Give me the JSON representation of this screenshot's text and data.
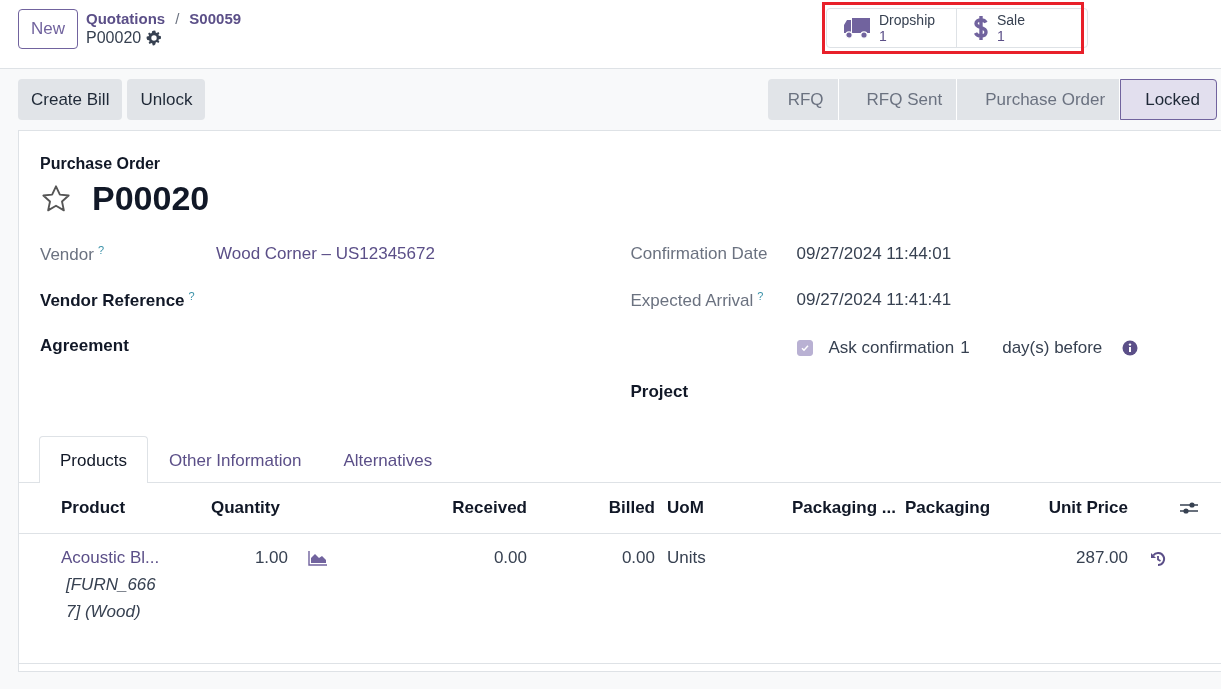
{
  "control_panel": {
    "new_button": "New",
    "breadcrumbs": [
      "Quotations",
      "S00059"
    ],
    "separator": "/",
    "record_name": "P00020"
  },
  "smart_buttons": [
    {
      "kind": "truck",
      "label": "Dropship",
      "value": "1"
    },
    {
      "kind": "dollar",
      "label": "Sale",
      "value": "1"
    }
  ],
  "highlighted": true,
  "action_buttons": [
    "Create Bill",
    "Unlock"
  ],
  "status_bar": [
    {
      "label": "RFQ",
      "selected": false
    },
    {
      "label": "RFQ Sent",
      "selected": false
    },
    {
      "label": "Purchase Order",
      "selected": false
    },
    {
      "label": "Locked",
      "selected": true
    }
  ],
  "form": {
    "caption": "Purchase Order",
    "starred": false,
    "name": "P00020",
    "left_fields": [
      {
        "label": "Vendor",
        "help": "?",
        "value": "Wood Corner – US12345672",
        "required": false
      },
      {
        "label": "Vendor Reference",
        "help": "?",
        "required": true
      },
      {
        "label": "Agreement",
        "required": true
      }
    ],
    "right_fields": [
      {
        "label": "Confirmation Date",
        "value": "09/27/2024 11:44:01",
        "required": false
      },
      {
        "label": "Expected Arrival",
        "help": "?",
        "value": "09/27/2024 11:41:41",
        "required": false
      }
    ],
    "confirmation": {
      "checked": true,
      "label": "Ask confirmation",
      "days": "1",
      "suffix": "day(s) before"
    },
    "project_label": "Project"
  },
  "tabs": [
    {
      "label": "Products",
      "selected": true
    },
    {
      "label": "Other Information",
      "selected": false
    },
    {
      "label": "Alternatives",
      "selected": false
    }
  ],
  "table": {
    "columns": [
      "Product",
      "Quantity",
      "Received",
      "Billed",
      "UoM",
      "Packaging ...",
      "Packaging",
      "Unit Price"
    ],
    "rows": [
      {
        "product": "Acoustic Bl...",
        "variant": "[FURN_6667] (Wood)",
        "quantity": "1.00",
        "received": "0.00",
        "billed": "0.00",
        "uom": "Units",
        "unit_price": "287.00"
      }
    ]
  }
}
